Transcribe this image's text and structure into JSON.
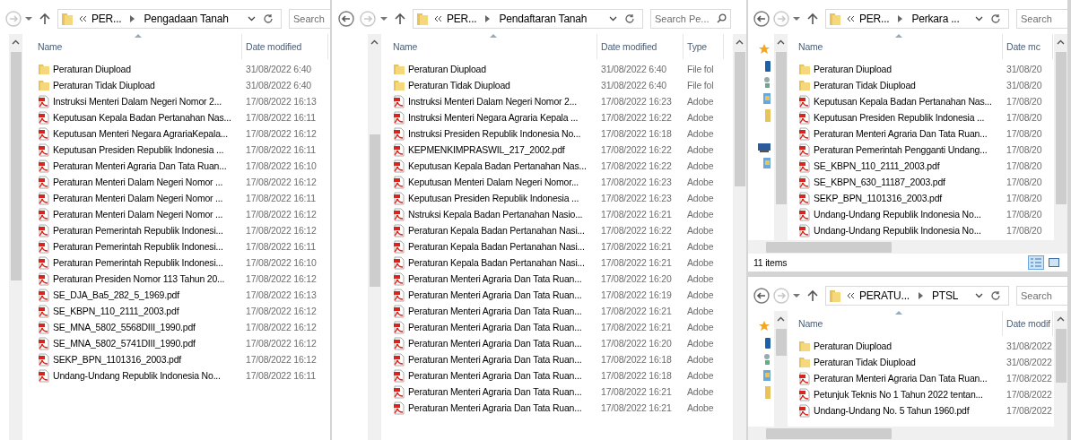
{
  "windows": [
    {
      "nav_buttons": [
        {
          "kind": "forward",
          "disabled": true
        }
      ],
      "address": {
        "crumbs": [
          "PER...",
          "Pengadaan Tanah"
        ]
      },
      "search": {
        "placeholder": "Search"
      },
      "columns": [
        "Name",
        "Date modified"
      ],
      "rows": [
        {
          "kind": "folder",
          "cells": [
            "Peraturan Diupload",
            "31/08/2022 6:40"
          ]
        },
        {
          "kind": "folder",
          "cells": [
            "Peraturan Tidak Diupload",
            "31/08/2022 6:40"
          ]
        },
        {
          "kind": "pdf",
          "cells": [
            "Instruksi Menteri Dalam Negeri Nomor  2...",
            "17/08/2022 16:13"
          ]
        },
        {
          "kind": "pdf",
          "cells": [
            "Keputusan Kepala Badan Pertanahan Nas...",
            "17/08/2022 16:11"
          ]
        },
        {
          "kind": "pdf",
          "cells": [
            "Keputusan Menteri Negara AgrariaKepala...",
            "17/08/2022 16:12"
          ]
        },
        {
          "kind": "pdf",
          "cells": [
            "Keputusan Presiden Republik Indonesia ...",
            "17/08/2022 16:11"
          ]
        },
        {
          "kind": "pdf",
          "cells": [
            "Peraturan Menteri Agraria Dan Tata Ruan...",
            "17/08/2022 16:10"
          ]
        },
        {
          "kind": "pdf",
          "cells": [
            "Peraturan Menteri Dalam Negeri Nomor ...",
            "17/08/2022 16:12"
          ]
        },
        {
          "kind": "pdf",
          "cells": [
            "Peraturan Menteri Dalam Negeri Nomor ...",
            "17/08/2022 16:11"
          ]
        },
        {
          "kind": "pdf",
          "cells": [
            "Peraturan Menteri Dalam Negeri Nomor ...",
            "17/08/2022 16:12"
          ]
        },
        {
          "kind": "pdf",
          "cells": [
            "Peraturan Pemerintah Republik Indonesi...",
            "17/08/2022 16:12"
          ]
        },
        {
          "kind": "pdf",
          "cells": [
            "Peraturan Pemerintah Republik Indonesi...",
            "17/08/2022 16:11"
          ]
        },
        {
          "kind": "pdf",
          "cells": [
            "Peraturan Pemerintah Republik Indonesi...",
            "17/08/2022 16:10"
          ]
        },
        {
          "kind": "pdf",
          "cells": [
            "Peraturan Presiden Nomor 113 Tahun 20...",
            "17/08/2022 16:12"
          ]
        },
        {
          "kind": "pdf",
          "cells": [
            "SE_DJA_Ba5_282_5_1969.pdf",
            "17/08/2022 16:13"
          ]
        },
        {
          "kind": "pdf",
          "cells": [
            "SE_KBPN_110_2111_2003.pdf",
            "17/08/2022 16:12"
          ]
        },
        {
          "kind": "pdf",
          "cells": [
            "SE_MNA_5802_5568DIII_1990.pdf",
            "17/08/2022 16:12"
          ]
        },
        {
          "kind": "pdf",
          "cells": [
            "SE_MNA_5802_5741DIII_1990.pdf",
            "17/08/2022 16:12"
          ]
        },
        {
          "kind": "pdf",
          "cells": [
            "SEKP_BPN_1101316_2003.pdf",
            "17/08/2022 16:12"
          ]
        },
        {
          "kind": "pdf",
          "cells": [
            "Undang-Undang Republik Indonesia No...",
            "17/08/2022 16:11"
          ]
        }
      ]
    },
    {
      "nav_buttons": [
        {
          "kind": "back",
          "disabled": false
        },
        {
          "kind": "forward",
          "disabled": true
        }
      ],
      "address": {
        "crumbs": [
          "PER...",
          "Pendaftaran Tanah"
        ]
      },
      "search": {
        "placeholder": "Search Pe...",
        "icon": true
      },
      "columns": [
        "Name",
        "Date modified",
        "Type"
      ],
      "rows": [
        {
          "kind": "folder",
          "cells": [
            "Peraturan Diupload",
            "31/08/2022 6:40",
            "File fol"
          ]
        },
        {
          "kind": "folder",
          "cells": [
            "Peraturan Tidak Diupload",
            "31/08/2022 6:40",
            "File fol"
          ]
        },
        {
          "kind": "pdf",
          "cells": [
            "Instruksi Menteri Dalam Negeri Nomor  2...",
            "17/08/2022 16:23",
            "Adobe"
          ]
        },
        {
          "kind": "pdf",
          "cells": [
            "Instruksi Menteri Negara Agraria Kepala ...",
            "17/08/2022 16:22",
            "Adobe"
          ]
        },
        {
          "kind": "pdf",
          "cells": [
            "Instruksi Presiden Republik Indonesia No...",
            "17/08/2022 16:18",
            "Adobe"
          ]
        },
        {
          "kind": "pdf",
          "cells": [
            "KEPMENKIMPRASWIL_217_2002.pdf",
            "17/08/2022 16:22",
            "Adobe"
          ]
        },
        {
          "kind": "pdf",
          "cells": [
            "Keputusan Kepala Badan Pertanahan Nas...",
            "17/08/2022 16:22",
            "Adobe"
          ]
        },
        {
          "kind": "pdf",
          "cells": [
            "Keputusan Menteri Dalam Negeri Nomor...",
            "17/08/2022 16:23",
            "Adobe"
          ]
        },
        {
          "kind": "pdf",
          "cells": [
            "Keputusan Presiden Republik Indonesia ...",
            "17/08/2022 16:23",
            "Adobe"
          ]
        },
        {
          "kind": "pdf",
          "cells": [
            "Nstruksi Kepala Badan Pertanahan Nasio...",
            "17/08/2022 16:21",
            "Adobe"
          ]
        },
        {
          "kind": "pdf",
          "cells": [
            "Peraturan Kepala Badan Pertanahan Nasi...",
            "17/08/2022 16:22",
            "Adobe"
          ]
        },
        {
          "kind": "pdf",
          "cells": [
            "Peraturan Kepala Badan Pertanahan Nasi...",
            "17/08/2022 16:21",
            "Adobe"
          ]
        },
        {
          "kind": "pdf",
          "cells": [
            "Peraturan Kepala Badan Pertanahan Nasi...",
            "17/08/2022 16:21",
            "Adobe"
          ]
        },
        {
          "kind": "pdf",
          "cells": [
            "Peraturan Menteri Agraria Dan Tata Ruan...",
            "17/08/2022 16:20",
            "Adobe"
          ]
        },
        {
          "kind": "pdf",
          "cells": [
            "Peraturan Menteri Agraria Dan Tata Ruan...",
            "17/08/2022 16:19",
            "Adobe"
          ]
        },
        {
          "kind": "pdf",
          "cells": [
            "Peraturan Menteri Agraria Dan Tata Ruan...",
            "17/08/2022 16:21",
            "Adobe"
          ]
        },
        {
          "kind": "pdf",
          "cells": [
            "Peraturan Menteri Agraria Dan Tata Ruan...",
            "17/08/2022 16:21",
            "Adobe"
          ]
        },
        {
          "kind": "pdf",
          "cells": [
            "Peraturan Menteri Agraria Dan Tata Ruan...",
            "17/08/2022 16:20",
            "Adobe"
          ]
        },
        {
          "kind": "pdf",
          "cells": [
            "Peraturan Menteri Agraria Dan Tata Ruan...",
            "17/08/2022 16:18",
            "Adobe"
          ]
        },
        {
          "kind": "pdf",
          "cells": [
            "Peraturan Menteri Agraria Dan Tata Ruan...",
            "17/08/2022 16:18",
            "Adobe"
          ]
        },
        {
          "kind": "pdf",
          "cells": [
            "Peraturan Menteri Agraria Dan Tata Ruan...",
            "17/08/2022 16:21",
            "Adobe"
          ]
        },
        {
          "kind": "pdf",
          "cells": [
            "Peraturan Menteri Agraria Dan Tata Ruan...",
            "17/08/2022 16:21",
            "Adobe"
          ]
        }
      ]
    },
    {
      "nav_buttons": [
        {
          "kind": "back",
          "disabled": false
        },
        {
          "kind": "forward",
          "disabled": true
        }
      ],
      "address": {
        "crumbs": [
          "PER...",
          "Perkara ..."
        ]
      },
      "search": {
        "placeholder": "Search"
      },
      "nav_items": [
        {
          "kind": "star"
        },
        {
          "kind": "device"
        },
        {
          "kind": "network"
        },
        {
          "kind": "library"
        },
        {
          "kind": "folder"
        },
        {
          "kind": "computer"
        },
        {
          "kind": "library"
        }
      ],
      "columns": [
        "Name",
        "Date mc"
      ],
      "rows": [
        {
          "kind": "folder",
          "cells": [
            "Peraturan Diupload",
            "31/08/20"
          ]
        },
        {
          "kind": "folder",
          "cells": [
            "Peraturan Tidak Diupload",
            "31/08/20"
          ]
        },
        {
          "kind": "pdf",
          "cells": [
            "Keputusan Kepala Badan Pertanahan Nas...",
            "17/08/20"
          ]
        },
        {
          "kind": "pdf",
          "cells": [
            "Keputusan Presiden Republik Indonesia ...",
            "17/08/20"
          ]
        },
        {
          "kind": "pdf",
          "cells": [
            "Peraturan Menteri Agraria Dan Tata Ruan...",
            "17/08/20"
          ]
        },
        {
          "kind": "pdf",
          "cells": [
            "Peraturan Pemerintah Pengganti Undang...",
            "17/08/20"
          ]
        },
        {
          "kind": "pdf",
          "cells": [
            "SE_KBPN_110_2111_2003.pdf",
            "17/08/20"
          ]
        },
        {
          "kind": "pdf",
          "cells": [
            "SE_KBPN_630_11187_2003.pdf",
            "17/08/20"
          ]
        },
        {
          "kind": "pdf",
          "cells": [
            "SEKP_BPN_1101316_2003.pdf",
            "17/08/20"
          ]
        },
        {
          "kind": "pdf",
          "cells": [
            "Undang-Undang Republik Indonesia No...",
            "17/08/20"
          ]
        },
        {
          "kind": "pdf",
          "cells": [
            "Undang-Undang Republik Indonesia No...",
            "17/08/20"
          ]
        }
      ],
      "status": {
        "text": "11 items",
        "views": [
          {
            "kind": "details",
            "selected": true
          },
          {
            "kind": "thumbnails",
            "selected": false
          }
        ]
      }
    },
    {
      "nav_buttons": [
        {
          "kind": "back",
          "disabled": false
        },
        {
          "kind": "forward",
          "disabled": true
        }
      ],
      "address": {
        "crumbs": [
          "PERATU...",
          "PTSL"
        ]
      },
      "search": {
        "placeholder": "Search"
      },
      "nav_items": [
        {
          "kind": "star"
        },
        {
          "kind": "device"
        },
        {
          "kind": "network"
        },
        {
          "kind": "library"
        },
        {
          "kind": "folder"
        }
      ],
      "columns": [
        "Name",
        "Date modif"
      ],
      "rows": [
        {
          "kind": "folder",
          "cells": [
            "Peraturan Diupload",
            "31/08/2022"
          ]
        },
        {
          "kind": "folder",
          "cells": [
            "Peraturan Tidak Diupload",
            "31/08/2022"
          ]
        },
        {
          "kind": "pdf",
          "cells": [
            "Peraturan Menteri Agraria Dan Tata Ruan...",
            "17/08/2022"
          ]
        },
        {
          "kind": "pdf",
          "cells": [
            "Petunjuk Teknis No 1 Tahun 2022 tentan...",
            "17/08/2022"
          ]
        },
        {
          "kind": "pdf",
          "cells": [
            "Undang-Undang No. 5 Tahun 1960.pdf",
            "17/08/2022"
          ]
        }
      ]
    }
  ]
}
